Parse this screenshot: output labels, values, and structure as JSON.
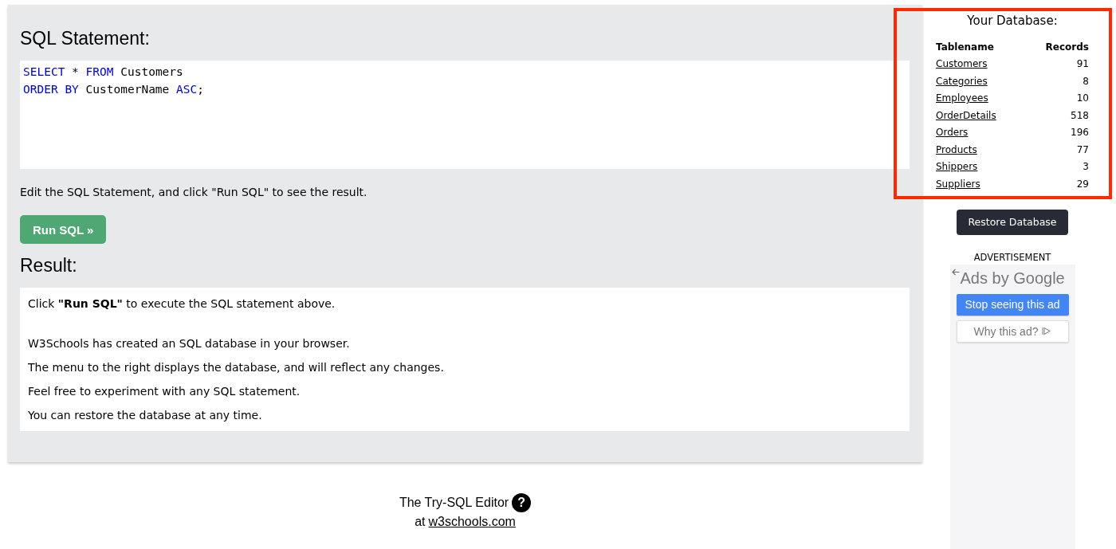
{
  "editor": {
    "heading": "SQL Statement:",
    "code_lines": [
      [
        {
          "kind": "keyword",
          "text": "SELECT"
        },
        {
          "kind": "plain",
          "text": " * "
        },
        {
          "kind": "keyword",
          "text": "FROM"
        },
        {
          "kind": "plain",
          "text": " Customers"
        }
      ],
      [
        {
          "kind": "keyword",
          "text": "ORDER BY"
        },
        {
          "kind": "plain",
          "text": " CustomerName "
        },
        {
          "kind": "keyword",
          "text": "ASC"
        },
        {
          "kind": "plain",
          "text": ";"
        }
      ]
    ]
  },
  "hint": "Edit the SQL Statement, and click \"Run SQL\" to see the result.",
  "run_button": "Run SQL »",
  "result": {
    "heading": "Result:",
    "paragraphs": [
      "Click **\"Run SQL\"** to execute the SQL statement above.",
      "W3Schools has created an SQL database in your browser.",
      "The menu to the right displays the database, and will reflect any changes.",
      "Feel free to experiment with any SQL statement.",
      "You can restore the database at any time."
    ]
  },
  "footer": {
    "title": "The Try-SQL Editor",
    "help_icon": "?",
    "prefix": "at",
    "link": "w3schools.com"
  },
  "database": {
    "title": "Your Database:",
    "columns": [
      "Tablename",
      "Records"
    ],
    "rows": [
      {
        "name": "Customers",
        "records": "91"
      },
      {
        "name": "Categories",
        "records": "8"
      },
      {
        "name": "Employees",
        "records": "10"
      },
      {
        "name": "OrderDetails",
        "records": "518"
      },
      {
        "name": "Orders",
        "records": "196"
      },
      {
        "name": "Products",
        "records": "77"
      },
      {
        "name": "Shippers",
        "records": "3"
      },
      {
        "name": "Suppliers",
        "records": "29"
      }
    ]
  },
  "restore_button": "Restore Database",
  "ad": {
    "label": "ADVERTISEMENT",
    "brand": "Ads by Google",
    "buttons": [
      {
        "kind": "primary",
        "label": "Stop seeing this ad"
      },
      {
        "kind": "secondary",
        "label": "Why this ad?"
      }
    ]
  }
}
